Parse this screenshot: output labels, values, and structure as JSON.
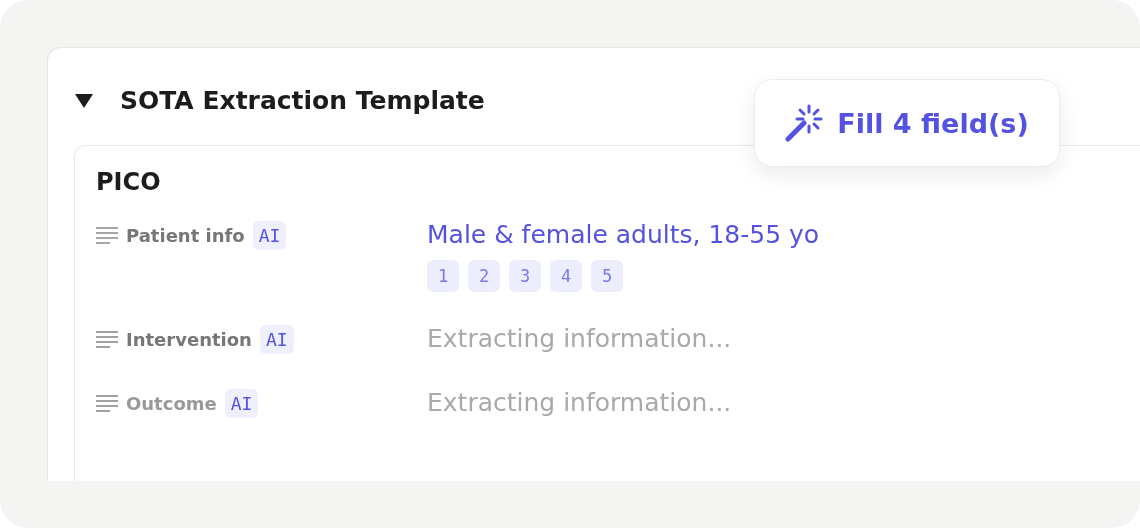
{
  "template": {
    "title": "SOTA Extraction Template",
    "expanded": true
  },
  "fill_button": {
    "label": "Fill 4 field(s)"
  },
  "section": {
    "title": "PICO",
    "fields": [
      {
        "kind": "filled",
        "label": "Patient info",
        "badge": "AI",
        "value": "Male & female adults, 18-55 yo",
        "citations": [
          "1",
          "2",
          "3",
          "4",
          "5"
        ]
      },
      {
        "kind": "pending",
        "label": "Intervention",
        "badge": "AI",
        "status": "Extracting information..."
      },
      {
        "kind": "pending",
        "label": "Outcome",
        "badge": "AI",
        "status": "Extracting information..."
      }
    ]
  }
}
